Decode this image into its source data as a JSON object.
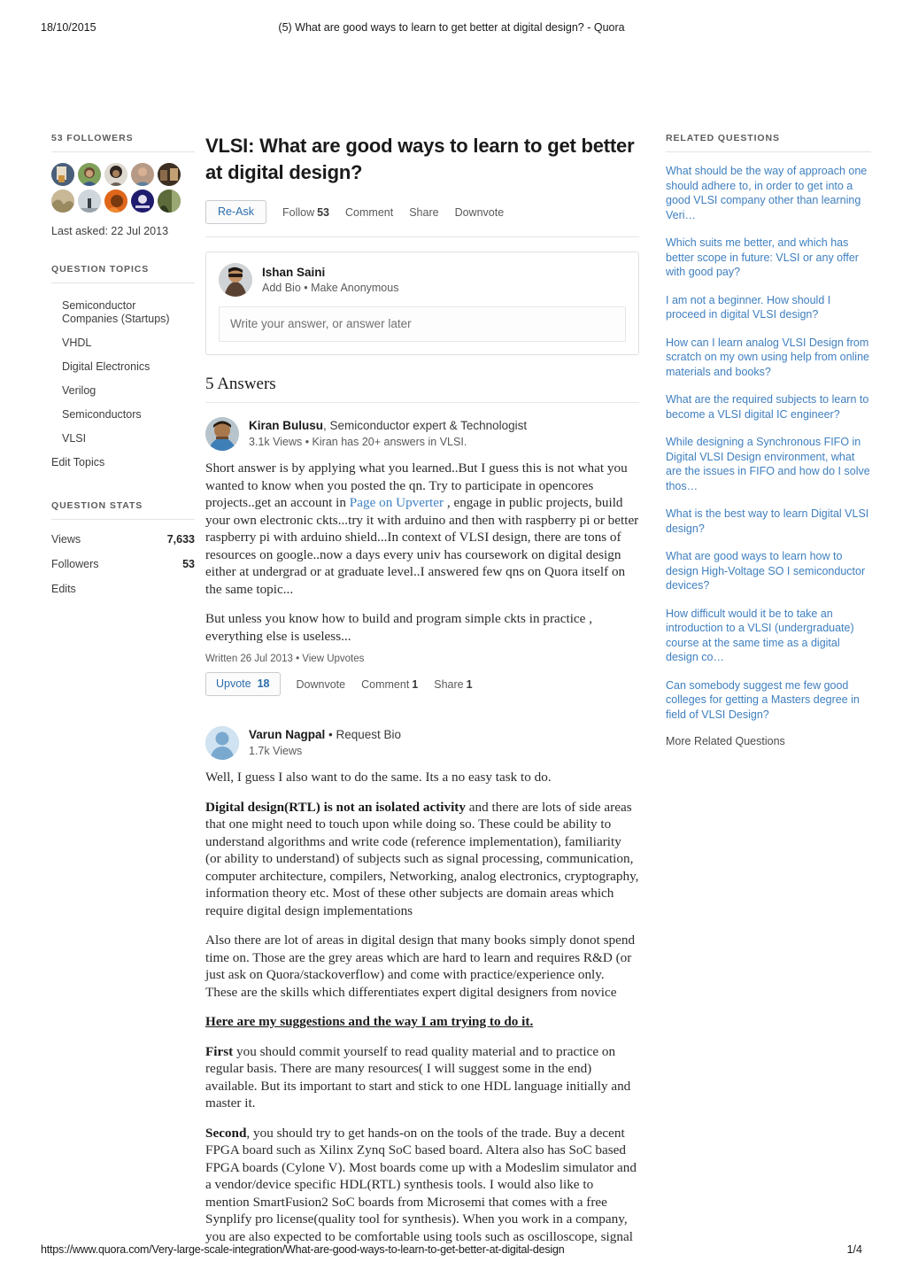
{
  "print": {
    "date": "18/10/2015",
    "doc_title": "(5) What are good ways to learn to get better at digital design? - Quora",
    "url": "https://www.quora.com/Very-large-scale-integration/What-are-good-ways-to-learn-to-get-better-at-digital-design",
    "page_number": "1/4"
  },
  "sidebar_left": {
    "followers_heading": "53 FOLLOWERS",
    "last_asked": "Last asked: 22 Jul 2013",
    "topics_heading": "QUESTION TOPICS",
    "topics": [
      "Semiconductor Companies (Startups)",
      "VHDL",
      "Digital Electronics",
      "Verilog",
      "Semiconductors",
      "VLSI"
    ],
    "edit_topics_label": "Edit Topics",
    "stats_heading": "QUESTION STATS",
    "stats": [
      {
        "label": "Views",
        "value": "7,633"
      },
      {
        "label": "Followers",
        "value": "53"
      },
      {
        "label": "Edits",
        "value": ""
      }
    ]
  },
  "question": {
    "title": "VLSI: What are good ways to learn to get better at digital design?",
    "re_ask_label": "Re-Ask",
    "follow_label": "Follow",
    "follow_count": "53",
    "comment_label": "Comment",
    "share_label": "Share",
    "downvote_label": "Downvote"
  },
  "composer": {
    "user_name": "Ishan Saini",
    "sub": "Add Bio • Make Anonymous",
    "placeholder": "Write your answer, or answer later"
  },
  "answers_heading": "5 Answers",
  "answers": [
    {
      "name": "Kiran Bulusu",
      "credential": ", Semiconductor expert & Technologist",
      "sub": "3.1k Views • Kiran has 20+ answers in VLSI.",
      "p1a": "Short answer is by applying what you learned..But I guess this is not what you wanted to know when you posted the qn. Try to participate in opencores projects..get an account in ",
      "link": "Page on Upverter",
      "p1b": "  , engage in public projects, build your own electronic ckts...try it with arduino and then with raspberry pi or better raspberry pi with arduino shield...In context of VLSI design, there are tons of resources on google..now a days every univ has coursework on digital design either at undergrad or at graduate level..I answered few qns on Quora itself on the same topic...",
      "p2": "But unless you know how to build and program simple ckts in practice , everything else is useless...",
      "written": "Written 26 Jul 2013 • View Upvotes",
      "upvote_label": "Upvote",
      "upvote_count": "18",
      "downvote_label": "Downvote",
      "comment_label": "Comment",
      "comment_count": "1",
      "share_label": "Share",
      "share_count": "1"
    },
    {
      "name": "Varun Nagpal",
      "credential": " • Request Bio",
      "sub": "1.7k Views",
      "p1": "Well, I guess I also want to do the same. Its a no easy task to do.",
      "p2_bold": "Digital design(RTL) is not an isolated activity",
      "p2_rest": " and there are lots of side areas that one might need to touch upon while doing so. These could be ability to understand algorithms and write code (reference implementation), familiarity (or ability to understand) of subjects such as signal processing, communication, computer architecture, compilers, Networking, analog electronics, cryptography, information theory etc. Most of these other subjects are domain areas which require digital design implementations",
      "p3": "Also there are lot of areas in digital design that many books simply donot spend time on. Those are the grey areas which are hard to learn and requires R&D (or just ask on Quora/stackoverflow) and come with practice/experience only. These are the skills which differentiates expert  digital designers from novice",
      "p4_underline": "Here are my suggestions and the way I am trying to do it. ",
      "p5_bold": "First",
      "p5_rest": " you should commit yourself to read quality material and to practice on regular basis. There are many resources( I will suggest some in the end) available. But its important to start and stick to one HDL language initially and master it.",
      "p6_bold": "Second",
      "p6_rest": ", you should try to get hands-on on the tools of the trade. Buy a decent FPGA board such as Xilinx Zynq SoC based board. Altera also has SoC based FPGA boards (Cylone V). Most boards come up with a Modeslim simulator and a vendor/device specific HDL(RTL) synthesis tools.  I would also like to mention SmartFusion2 SoC boards from Microsemi that comes with a free Synplify pro license(quality tool for synthesis). When you work in a company, you are also expected to be comfortable using tools such as oscilloscope, signal"
    }
  ],
  "sidebar_right": {
    "heading": "RELATED QUESTIONS",
    "questions": [
      "What should be the way of approach one should adhere to, in order to get into a good VLSI company other than learning Veri…",
      "Which suits me better, and which has better scope in future: VLSI or any offer with good pay?",
      "I am not a beginner. How should I proceed in digital VLSI design?",
      "How can I learn analog VLSI Design from scratch on my own using help from online materials and books?",
      "What are the required subjects to learn to become a VLSI digital IC engineer?",
      "While designing a Synchronous FIFO in Digital VLSI Design environment, what are the issues in FIFO and how do I solve thos…",
      "What is the best way to learn Digital VLSI design?",
      "What are good ways to learn how to design High-Voltage SO I semiconductor devices?",
      "How difficult would it be to take an introduction to a VLSI (undergraduate) course at the same time as a digital design co…",
      "Can somebody suggest me few good colleges for getting a Masters degree in field of VLSI Design?"
    ],
    "more_label": "More Related Questions"
  },
  "colors": {
    "link_blue": "#3f7fbf",
    "button_blue": "#2b6dad",
    "text": "#2b2b2b",
    "muted": "#5a5a5a"
  }
}
